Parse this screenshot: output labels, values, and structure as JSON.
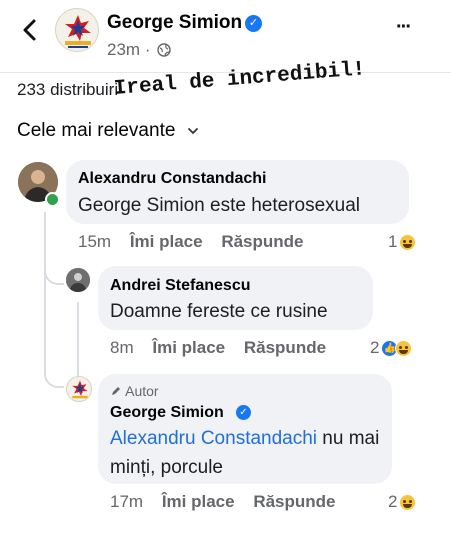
{
  "header": {
    "back_icon": "chevron-left-icon",
    "page_name": "George Simion",
    "time": "23m",
    "separator": "·",
    "privacy_icon": "globe-icon",
    "more_icon": "more-dots-icon",
    "more_label": "···"
  },
  "post_stats": {
    "shares": "233 distribuiri"
  },
  "overlay_caption": "Ireal de incredibil!",
  "sort": {
    "label": "Cele mai relevante",
    "icon": "chevron-down-icon"
  },
  "comments": [
    {
      "author": "Alexandru Constandachi",
      "text": "George Simion este heterosexual",
      "time": "15m",
      "like_label": "Îmi place",
      "reply_label": "Răspunde",
      "reaction_count": "1",
      "online": true
    },
    {
      "author": "Andrei Stefanescu",
      "text": "Doamne fereste ce rusine",
      "time": "8m",
      "like_label": "Îmi place",
      "reply_label": "Răspunde",
      "reaction_count": "2"
    },
    {
      "badge": "Autor",
      "author": "George Simion",
      "mention": "Alexandru Constandachi",
      "text": " nu mai minți, porcule",
      "time": "17m",
      "like_label": "Îmi place",
      "reply_label": "Răspunde",
      "reaction_count": "2"
    }
  ],
  "colors": {
    "accent": "#1877f2",
    "bubble": "#f0f2f5",
    "muted": "#65676b",
    "caption": "#111111"
  }
}
